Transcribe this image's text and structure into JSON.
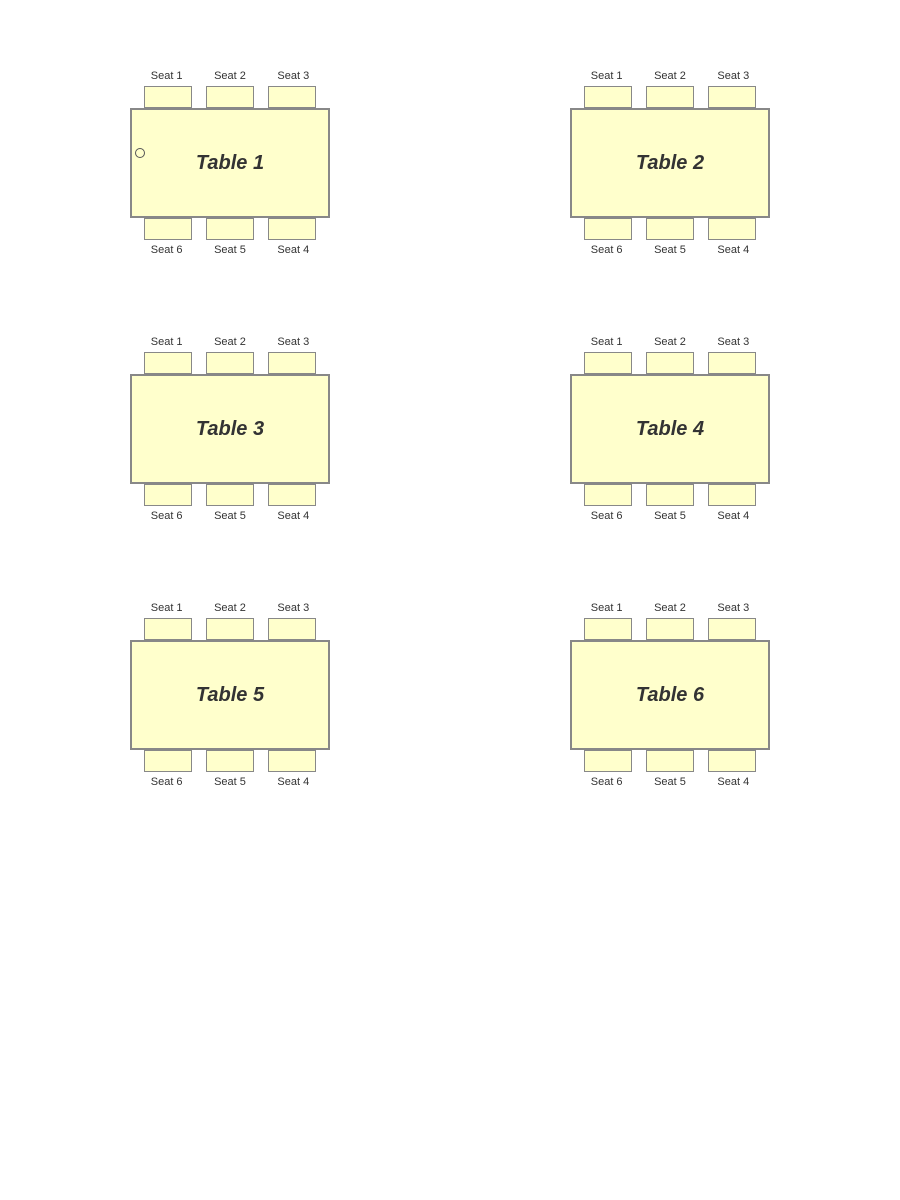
{
  "tables": [
    {
      "id": "table1",
      "name": "Table 1",
      "top_seats": [
        "Seat 1",
        "Seat 2",
        "Seat 3"
      ],
      "bottom_seats": [
        "Seat 6",
        "Seat 5",
        "Seat 4"
      ]
    },
    {
      "id": "table2",
      "name": "Table 2",
      "top_seats": [
        "Seat 1",
        "Seat 2",
        "Seat 3"
      ],
      "bottom_seats": [
        "Seat 6",
        "Seat 5",
        "Seat 4"
      ]
    },
    {
      "id": "table3",
      "name": "Table 3",
      "top_seats": [
        "Seat 1",
        "Seat 2",
        "Seat 3"
      ],
      "bottom_seats": [
        "Seat 6",
        "Seat 5",
        "Seat 4"
      ]
    },
    {
      "id": "table4",
      "name": "Table 4",
      "top_seats": [
        "Seat 1",
        "Seat 2",
        "Seat 3"
      ],
      "bottom_seats": [
        "Seat 6",
        "Seat 5",
        "Seat 4"
      ]
    },
    {
      "id": "table5",
      "name": "Table 5",
      "top_seats": [
        "Seat 1",
        "Seat 2",
        "Seat 3"
      ],
      "bottom_seats": [
        "Seat 6",
        "Seat 5",
        "Seat 4"
      ]
    },
    {
      "id": "table6",
      "name": "Table 6",
      "top_seats": [
        "Seat 1",
        "Seat 2",
        "Seat 3"
      ],
      "bottom_seats": [
        "Seat 6",
        "Seat 5",
        "Seat 4"
      ]
    }
  ]
}
